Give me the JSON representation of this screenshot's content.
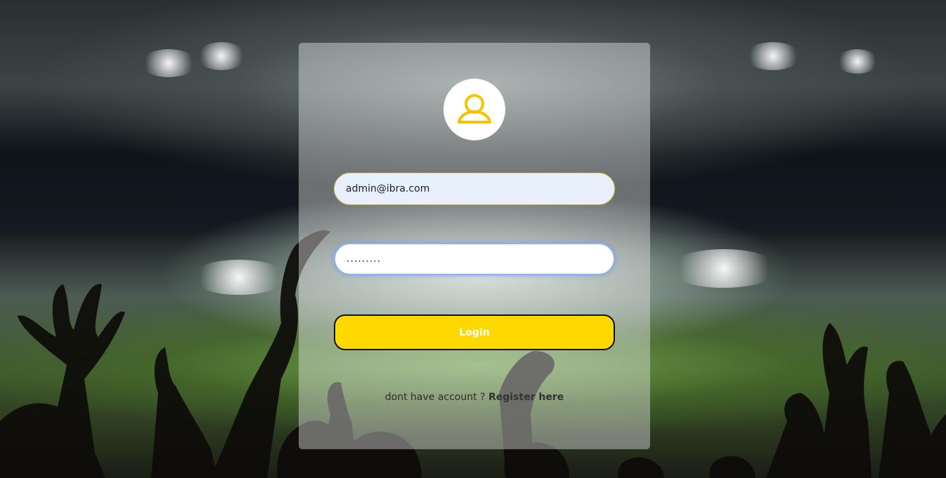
{
  "theme": {
    "accent": "#ffd800",
    "icon_color": "#f5c400",
    "card_background": "rgba(235,235,235,0.42)"
  },
  "login_form": {
    "avatar_icon": "user-icon",
    "email_value": "admin@ibra.com",
    "password_value": ".........",
    "login_label": "Login",
    "register_prompt": "dont have account ?",
    "register_link": "Register here"
  }
}
